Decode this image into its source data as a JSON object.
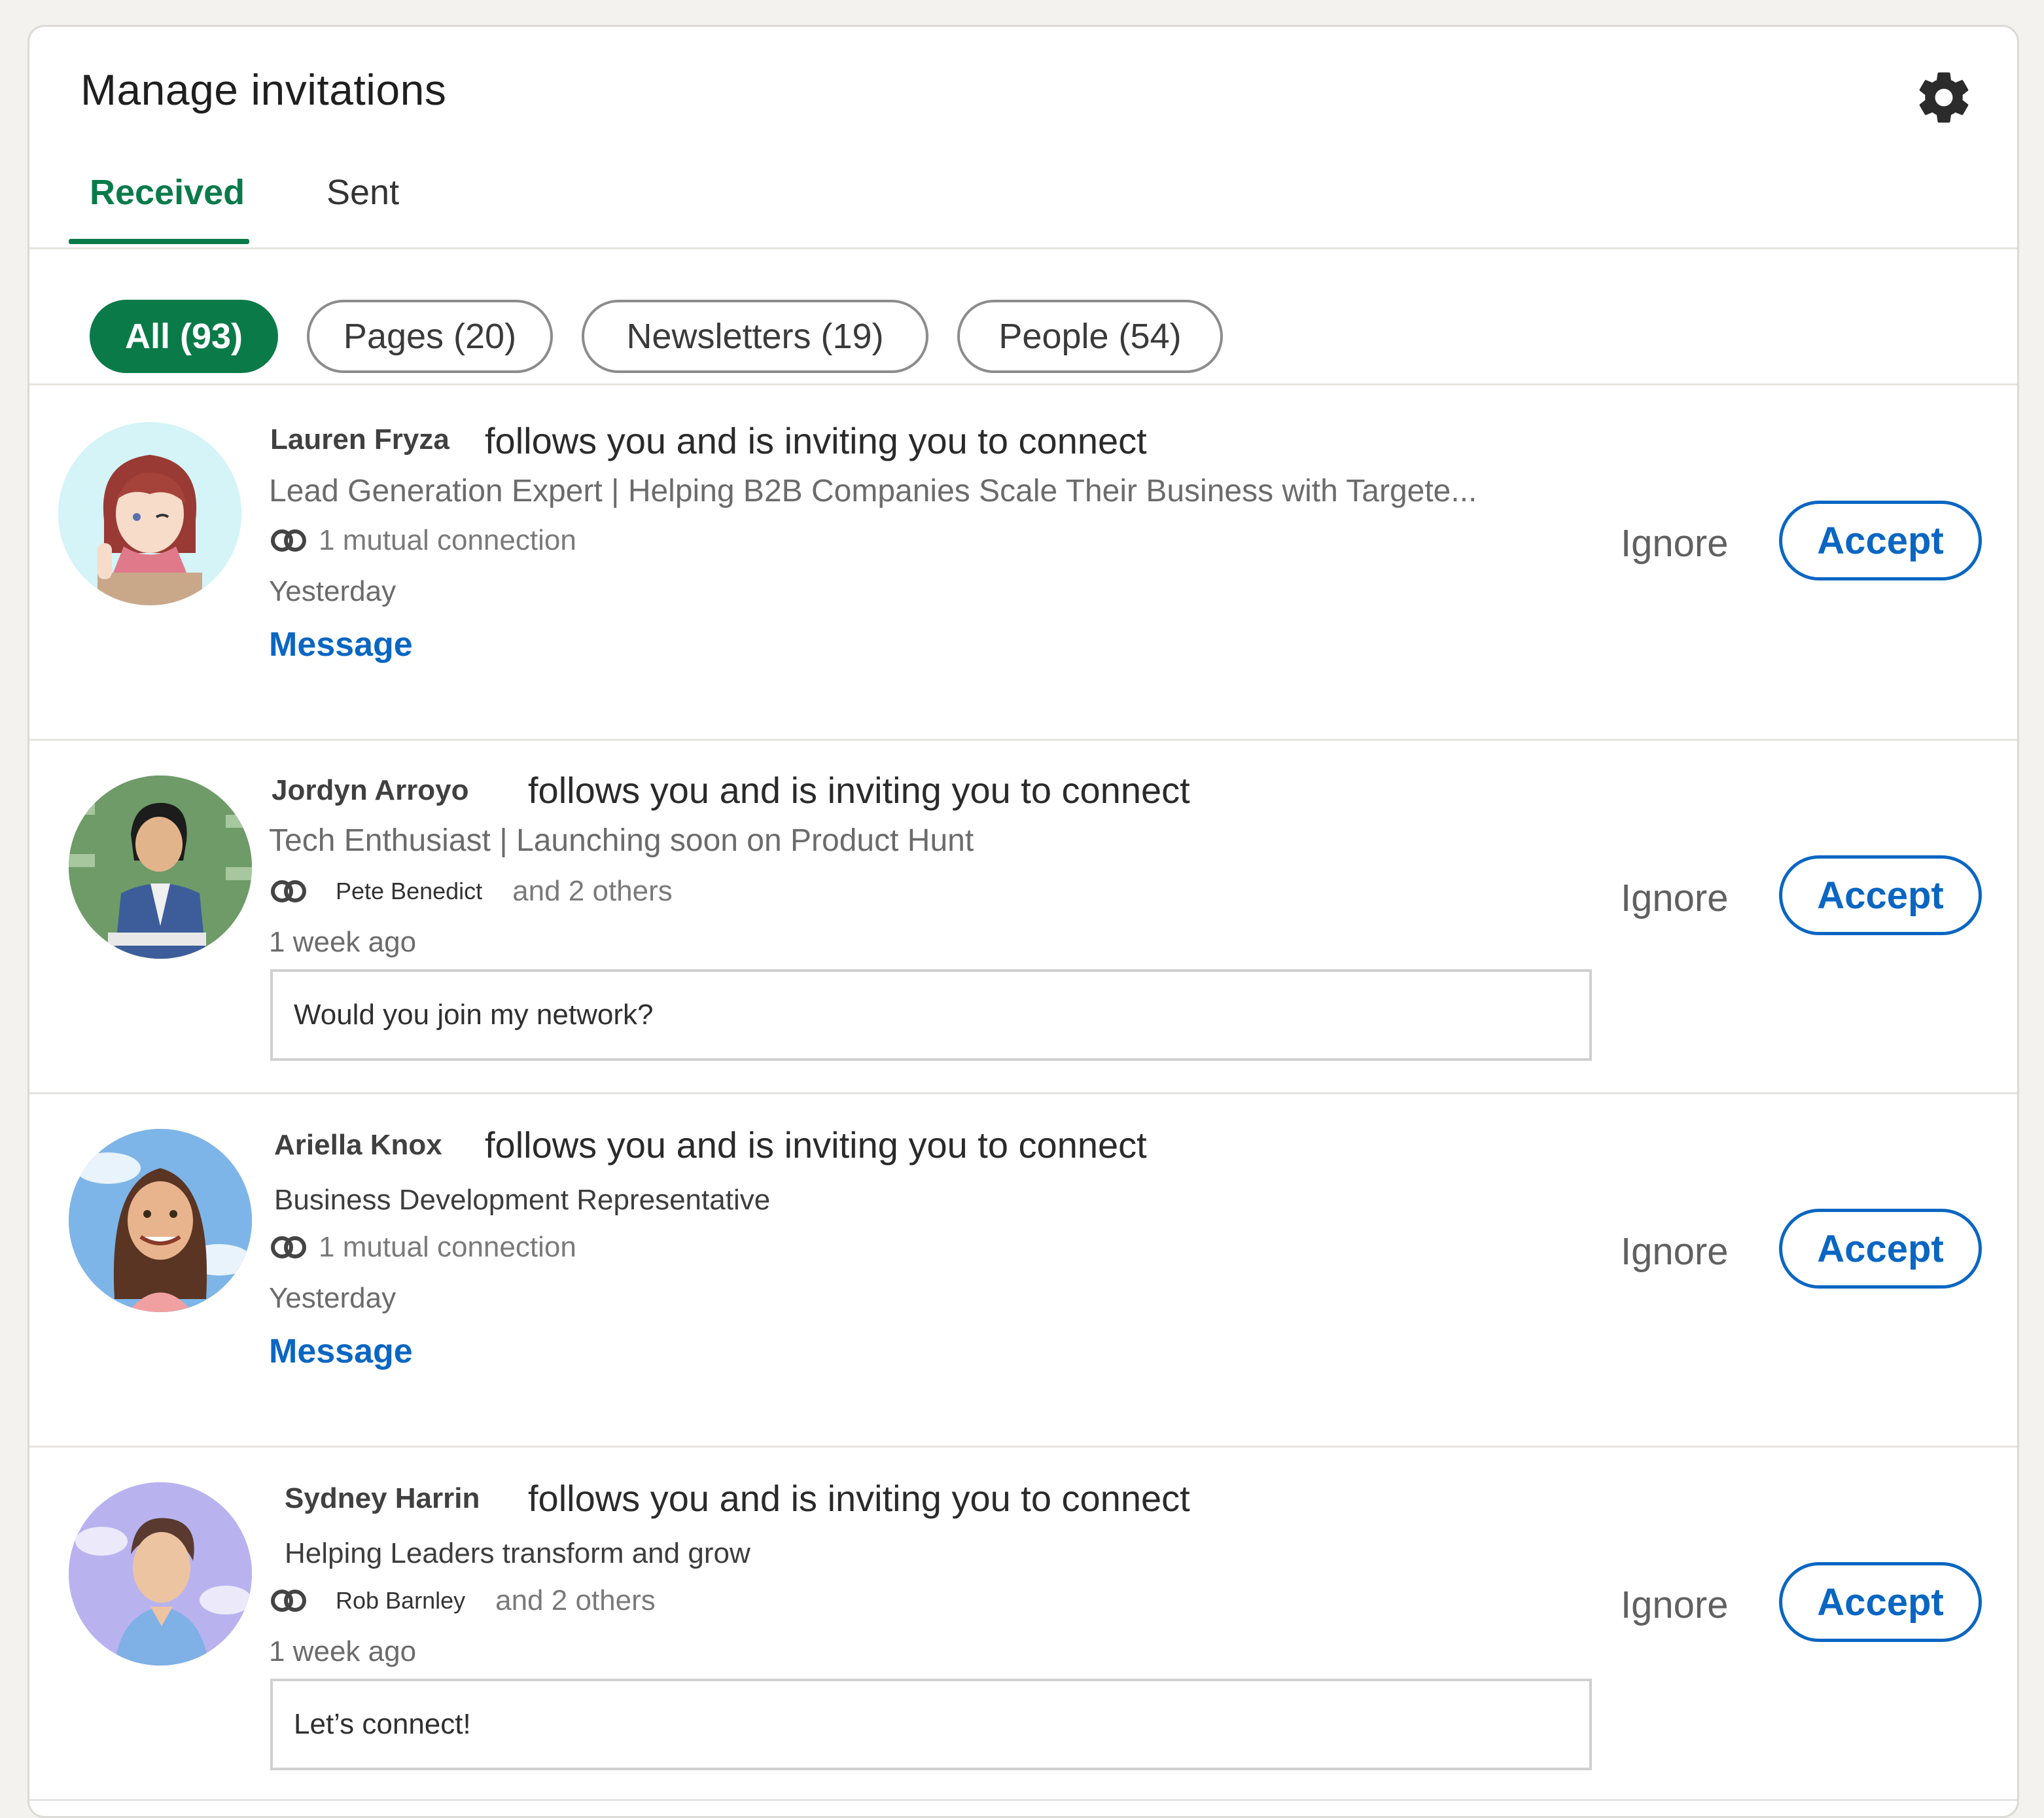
{
  "page": {
    "title": "Manage invitations",
    "settings_icon": "gear-icon"
  },
  "tabs": [
    {
      "label": "Received",
      "active": true
    },
    {
      "label": "Sent",
      "active": false
    }
  ],
  "filters": [
    {
      "label": "All (93)",
      "active": true
    },
    {
      "label": "Pages (20)",
      "active": false
    },
    {
      "label": "Newsletters (19)",
      "active": false
    },
    {
      "label": "People (54)",
      "active": false
    }
  ],
  "invitations": [
    {
      "name": "Lauren Fryza",
      "action": "follows you and is inviting you to connect",
      "headline": "Lead Generation Expert | Helping B2B Companies Scale Their Business with Targete...",
      "mutual_name": "",
      "mutual_text": "1 mutual connection",
      "time": "Yesterday",
      "message_label": "Message",
      "note": "",
      "ignore_label": "Ignore",
      "accept_label": "Accept"
    },
    {
      "name": "Jordyn Arroyo",
      "action": "follows you and is inviting you to connect",
      "headline": "Tech Enthusiast | Launching soon on Product Hunt",
      "mutual_name": "Pete Benedict",
      "mutual_text": "and 2 others",
      "time": "1 week ago",
      "message_label": "",
      "note": "Would you join my network?",
      "ignore_label": "Ignore",
      "accept_label": "Accept"
    },
    {
      "name": "Ariella Knox",
      "action": "follows you and is inviting you to connect",
      "headline": "Business Development Representative",
      "mutual_name": "",
      "mutual_text": "1 mutual connection",
      "time": "Yesterday",
      "message_label": "Message",
      "note": "",
      "ignore_label": "Ignore",
      "accept_label": "Accept"
    },
    {
      "name": "Sydney Harrin",
      "action": "follows you and is inviting you to connect",
      "headline": "Helping Leaders transform and grow",
      "mutual_name": "Rob Barnley",
      "mutual_text": "and 2 others",
      "time": "1 week ago",
      "message_label": "",
      "note": "Let’s connect!",
      "ignore_label": "Ignore",
      "accept_label": "Accept"
    }
  ],
  "colors": {
    "green_accent": "#0a7a48",
    "link_blue": "#0a66c2",
    "background": "#f3f2ef"
  }
}
